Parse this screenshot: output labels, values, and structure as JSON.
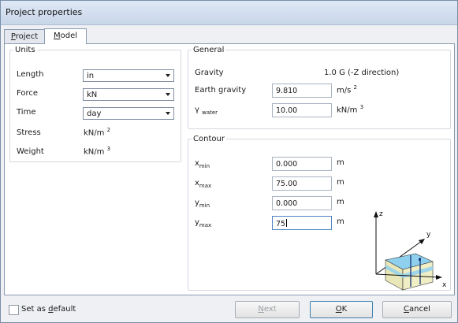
{
  "window": {
    "title": "Project properties"
  },
  "tabs": [
    {
      "pre": "",
      "acc": "P",
      "post": "roject"
    },
    {
      "pre": "",
      "acc": "M",
      "post": "odel"
    }
  ],
  "units": {
    "legend": "Units",
    "length": {
      "label": "Length",
      "value": "in"
    },
    "force": {
      "label": "Force",
      "value": "kN"
    },
    "time": {
      "label": "Time",
      "value": "day"
    },
    "stress": {
      "label": "Stress",
      "unit": "kN/m",
      "exp": "2"
    },
    "weight": {
      "label": "Weight",
      "unit": "kN/m",
      "exp": "3"
    }
  },
  "general": {
    "legend": "General",
    "gravity": {
      "label": "Gravity",
      "value": "1.0",
      "unit": "G (-Z direction)"
    },
    "earth": {
      "label": "Earth gravity",
      "value": "9.810",
      "unit": "m/s",
      "exp": "2"
    },
    "water": {
      "label": "γ",
      "sub": "water",
      "value": "10.00",
      "unit": "kN/m",
      "exp": "3"
    }
  },
  "contour": {
    "legend": "Contour",
    "xmin": {
      "label": "x",
      "sub": "min",
      "value": "0.000",
      "unit": "m"
    },
    "xmax": {
      "label": "x",
      "sub": "max",
      "value": "75.00",
      "unit": "m"
    },
    "ymin": {
      "label": "y",
      "sub": "min",
      "value": "0.000",
      "unit": "m"
    },
    "ymax": {
      "label": "y",
      "sub": "max",
      "value": "75",
      "unit": "m"
    },
    "axes": {
      "z": "z",
      "y": "y",
      "x": "x"
    }
  },
  "footer": {
    "default": {
      "pre": "Set as ",
      "acc": "d",
      "post": "efault"
    },
    "next": {
      "pre": "",
      "acc": "N",
      "post": "ext"
    },
    "ok": {
      "pre": "",
      "acc": "O",
      "post": "K"
    },
    "cancel": {
      "pre": "",
      "acc": "C",
      "post": "ancel"
    }
  },
  "icons": {
    "dropdown": "chevron-down-icon",
    "model": "soil-box-icon"
  }
}
